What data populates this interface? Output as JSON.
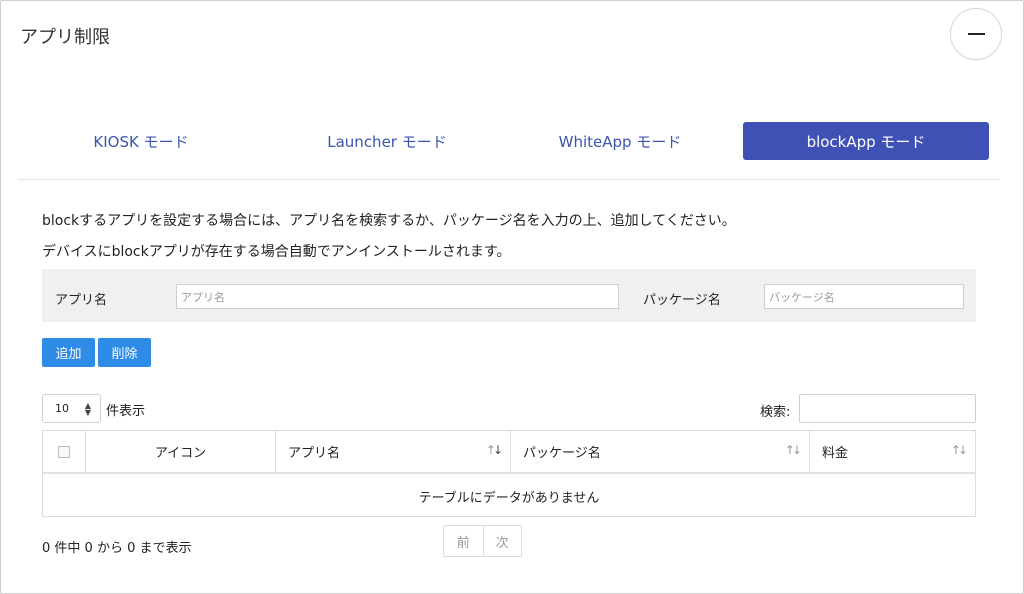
{
  "header": {
    "title": "アプリ制限"
  },
  "tabs": [
    {
      "label": "KIOSK モード",
      "active": false
    },
    {
      "label": "Launcher モード",
      "active": false
    },
    {
      "label": "WhiteApp モード",
      "active": false
    },
    {
      "label": "blockApp モード",
      "active": true
    }
  ],
  "description": [
    "blockするアプリを設定する場合には、アプリ名を検索するか、パッケージ名を入力の上、追加してください。",
    "デバイスにblockアプリが存在する場合自動でアンインストールされます。"
  ],
  "filter": {
    "app_name_label": "アプリ名",
    "app_name_placeholder": "アプリ名",
    "package_label": "パッケージ名",
    "package_placeholder": "パッケージ名"
  },
  "actions": {
    "add_label": "追加",
    "delete_label": "削除"
  },
  "table_controls": {
    "page_length": "10",
    "page_length_suffix": "件表示",
    "search_label": "検索:"
  },
  "table": {
    "columns": [
      "アイコン",
      "アプリ名",
      "パッケージ名",
      "料金"
    ],
    "empty_message": "テーブルにデータがありません"
  },
  "footer": {
    "info": "0 件中 0 から 0 まで表示",
    "prev_label": "前",
    "next_label": "次"
  },
  "colors": {
    "accent": "#3f51b5",
    "button": "#2f8ce6",
    "tab_text": "#3b55b0"
  },
  "icons": [
    "minus-icon",
    "select-arrows-icon",
    "sort-icon"
  ]
}
